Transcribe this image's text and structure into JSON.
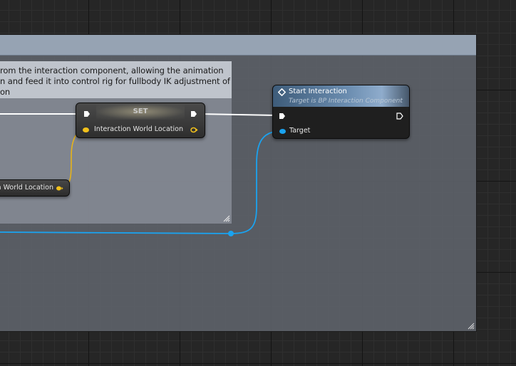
{
  "comment": {
    "lines": [
      "rom the interaction component, allowing the animation",
      "n and feed it into control rig for fullbody IK adjustment of",
      "on"
    ]
  },
  "set_node": {
    "title": "SET",
    "input_pin_label": "Interaction World Location"
  },
  "get_node": {
    "output_pin_label": "on World Location"
  },
  "start_interaction_node": {
    "title": "Start Interaction",
    "subtitle": "Target is BP Interaction Component",
    "target_pin_label": "Target"
  },
  "colors": {
    "vector_pin": "#f2c11b",
    "object_pin": "#1aa3f0",
    "exec_wire": "#ffffff"
  },
  "icons": {
    "function": "function-icon",
    "resize": "resize-grip-icon"
  }
}
